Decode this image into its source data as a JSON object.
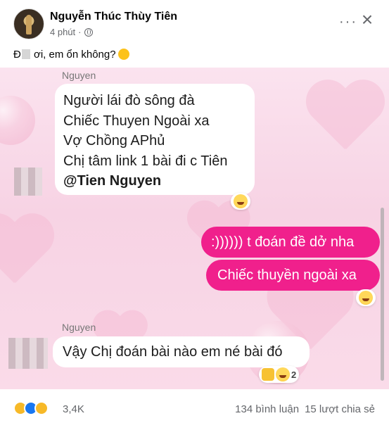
{
  "post": {
    "author": "Nguyễn Thúc Thùy Tiên",
    "time": "4 phút",
    "more_label": "···",
    "close_label": "×",
    "caption_start": "Đ",
    "caption_end": " ơi, em ổn không?"
  },
  "chat": {
    "group1": {
      "sender": "Nguyen",
      "lines": [
        "Người lái đò sông đà",
        "Chiếc Thuyen Ngoài xa",
        "Vợ Chồng APhủ",
        "Chị tâm link 1 bài đi c Tiên"
      ],
      "mention": "@Tien Nguyen"
    },
    "outgoing": [
      ":)))))) t đoán đề dở nha",
      "Chiếc thuyền ngoài xa"
    ],
    "group2": {
      "sender": "Nguyen",
      "text": "Vậy Chị đoán bài nào em né bài đó",
      "reaction_count": "2"
    }
  },
  "footer": {
    "reaction_total": "3,4K",
    "comments": "134 bình luận",
    "shares": "15 lượt chia sẻ"
  },
  "colors": {
    "accent_pink": "#f0208c",
    "facebook_blue": "#1877f2"
  }
}
